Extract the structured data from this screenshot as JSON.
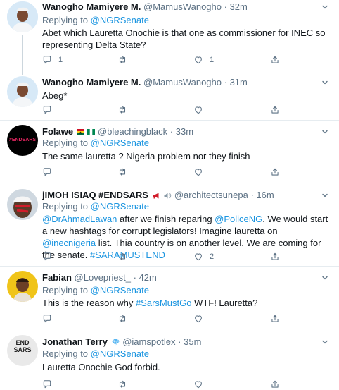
{
  "tweets": [
    {
      "name": "Wanogho Mamiyere M.",
      "handle": "@MamusWanogho",
      "time": "32m",
      "replying_prefix": "Replying to",
      "replying_to": "@NGRSenate",
      "text": "Abet which Lauretta Onochie is that one as commissioner for INEC so representing Delta State?",
      "reply_count": "1",
      "retweet_count": "",
      "like_count": "1"
    },
    {
      "name": "Wanogho Mamiyere M.",
      "handle": "@MamusWanogho",
      "time": "31m",
      "text": "Abeg*",
      "reply_count": "",
      "retweet_count": "",
      "like_count": ""
    },
    {
      "name": "Folawe",
      "handle": "@bleachingblack",
      "time": "33m",
      "avatar_text": "#ENDSARS",
      "replying_prefix": "Replying to",
      "replying_to": "@NGRSenate",
      "text": "The same lauretta ? Nigeria problem nor they finish",
      "reply_count": "",
      "retweet_count": "",
      "like_count": ""
    },
    {
      "name": "jIMOH ISIAQ #ENDSARS",
      "handle": "@architectsunepa",
      "time": "16m",
      "replying_prefix": "Replying to",
      "replying_to": "@NGRSenate",
      "text_parts": [
        "@DrAhmadLawan",
        " after we finish reparing ",
        "@PoliceNG",
        ". We would start a new hashtags for corrupt legislators! Imagine lauretta on ",
        "@inecnigeria",
        " list. Thia country is on another level. We are coming for the senate. ",
        "#SARAMUSTEND"
      ],
      "reply_count": "",
      "retweet_count": "",
      "like_count": "2"
    },
    {
      "name": "Fabian",
      "handle": "@Lovepriest_",
      "time": "42m",
      "replying_prefix": "Replying to",
      "replying_to": "@NGRSenate",
      "text_parts": [
        "This is the reason why ",
        "#SarsMustGo",
        " WTF! Lauretta?"
      ],
      "reply_count": "",
      "retweet_count": "",
      "like_count": ""
    },
    {
      "name": "Jonathan Terry",
      "handle": "@iamspotlex",
      "time": "35m",
      "avatar_text": "END SARS",
      "replying_prefix": "Replying to",
      "replying_to": "@NGRSenate",
      "text": "Lauretta Onochie God forbid."
    }
  ],
  "icons": {
    "reply": "reply-icon",
    "retweet": "retweet-icon",
    "like": "heart-icon",
    "share": "share-icon",
    "more": "chevron-down-icon",
    "verified": "diamond-icon",
    "megaphone": "megaphone-icon",
    "speaker": "speaker-icon"
  },
  "colors": {
    "link": "#1b95e0",
    "secondary_text": "#5b7083",
    "separator": "#e6ecf0",
    "thread_line": "#ccd6dd"
  }
}
